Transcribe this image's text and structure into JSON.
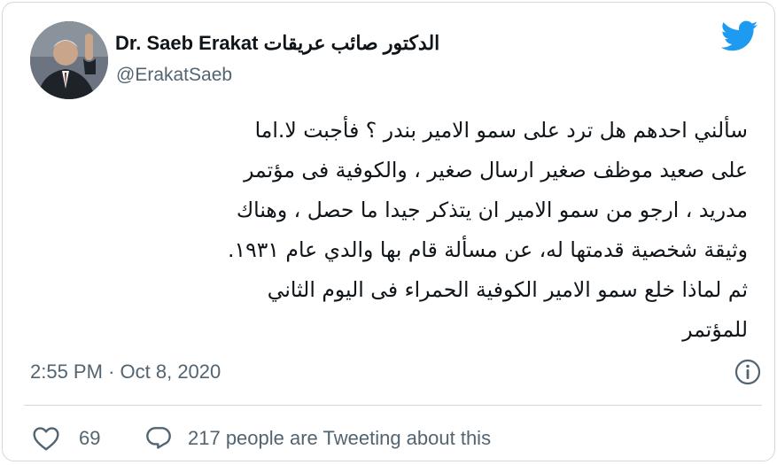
{
  "author": {
    "name_en": "Dr. Saeb Erakat",
    "name_ar": "الدكتور صائب عريقات",
    "handle": "@ErakatSaeb",
    "avatar_icon": "profile-photo"
  },
  "brand": {
    "icon": "twitter-bird-icon",
    "color": "#1d9bf0"
  },
  "tweet": {
    "lines": [
      "سألني احدهم هل ترد على سمو الامير بندر ؟ فأجبت لا.اما",
      "على صعيد موظف صغير ارسال صغير ، والكوفية فى مؤتمر",
      "مدريد ، ارجو من سمو الامير ان يتذكر جيدا ما حصل ، وهناك",
      "وثيقة شخصية قدمتها له، عن مسألة قام بها والدي عام ١٩٣١.",
      "ثم لماذا خلع سمو الامير الكوفية الحمراء فى اليوم الثاني",
      "للمؤتمر"
    ],
    "time": "2:55 PM",
    "separator": "·",
    "date": "Oct 8, 2020"
  },
  "actions": {
    "like_count": "69",
    "conversation_text": "217 people are Tweeting about this"
  },
  "colors": {
    "secondary_text": "#536471",
    "border": "#cfd9de"
  }
}
